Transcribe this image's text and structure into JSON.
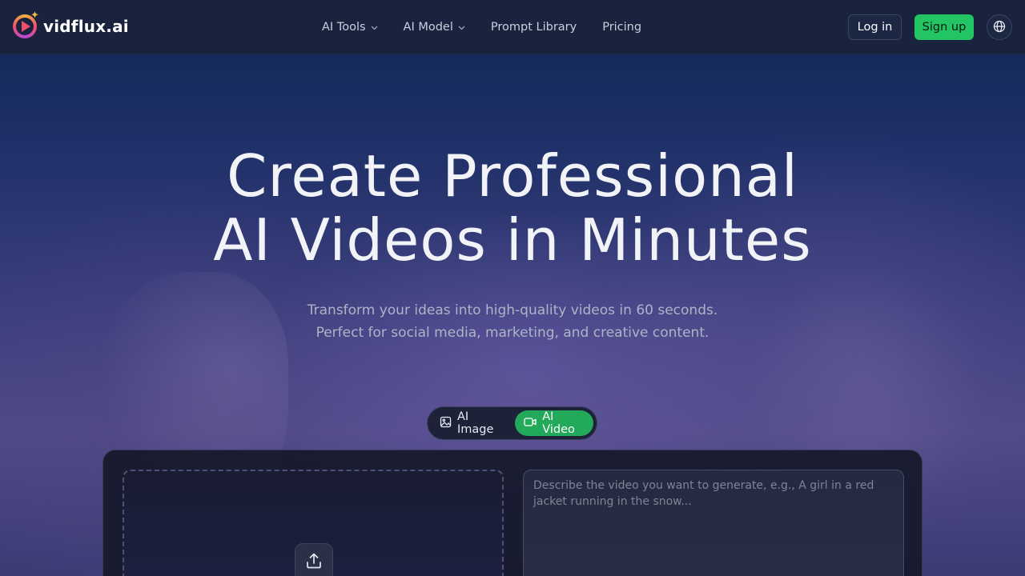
{
  "brand": {
    "name": "vidflux.ai"
  },
  "nav": [
    {
      "label": "AI Tools",
      "dropdown": true
    },
    {
      "label": "AI Model",
      "dropdown": true
    },
    {
      "label": "Prompt Library",
      "dropdown": false
    },
    {
      "label": "Pricing",
      "dropdown": false
    }
  ],
  "auth": {
    "login_label": "Log in",
    "signup_label": "Sign up"
  },
  "hero": {
    "title_line1": "Create Professional",
    "title_line2": "AI Videos in Minutes",
    "subtitle_line1": "Transform your ideas into high-quality videos in 60 seconds.",
    "subtitle_line2": "Perfect for social media, marketing, and creative content."
  },
  "mode_switch": {
    "image_label": "AI Image",
    "video_label": "AI Video",
    "selected": "AI Video"
  },
  "generator": {
    "prompt_placeholder": "Describe the video you want to generate, e.g., A girl in a red jacket running in the snow...",
    "prompt_value": ""
  },
  "colors": {
    "accent": "#22c463",
    "header_bg": "#19233e",
    "switch_active": "#22a95a"
  },
  "icons": {
    "logo": "play-circle-sparkle-icon",
    "language": "globe-icon",
    "image_mode": "image-icon",
    "video_mode": "video-camera-icon",
    "upload": "upload-icon"
  }
}
